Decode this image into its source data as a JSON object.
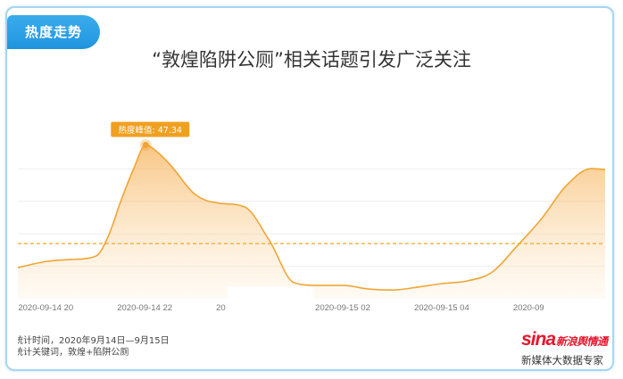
{
  "header": {
    "tab_label": "热度走势",
    "title": "“敦煌陷阱公厕”相关话题引发广泛关注"
  },
  "chart_data": {
    "type": "area",
    "x": [
      "2020-09-14 19:25",
      "2020-09-14 20:00",
      "2020-09-14 20:30",
      "2020-09-14 21:00",
      "2020-09-14 21:15",
      "2020-09-14 21:30",
      "2020-09-14 21:45",
      "2020-09-14 22:00",
      "2020-09-14 22:15",
      "2020-09-14 22:30",
      "2020-09-14 23:00",
      "2020-09-14 23:30",
      "2020-09-15 00:00",
      "2020-09-15 00:30",
      "2020-09-15 01:00",
      "2020-09-15 01:30",
      "2020-09-15 02:00",
      "2020-09-15 02:30",
      "2020-09-15 03:00",
      "2020-09-15 03:30",
      "2020-09-15 04:00",
      "2020-09-15 04:30",
      "2020-09-15 05:00",
      "2020-09-15 05:30",
      "2020-09-15 06:00",
      "2020-09-15 06:30",
      "2020-09-15 07:00",
      "2020-09-15 07:17"
    ],
    "series": [
      {
        "values": [
          9.6,
          11.5,
          12.1,
          13.2,
          19.5,
          30.2,
          39.8,
          47.34,
          45.0,
          41.2,
          32.1,
          29.4,
          28.3,
          17.9,
          4.9,
          4.1,
          4.1,
          3.0,
          2.7,
          3.6,
          4.7,
          5.5,
          8.2,
          16.2,
          24.7,
          34.9,
          40.1,
          39.8
        ]
      }
    ],
    "xlim": [
      "2020-09-14 19:25",
      "2020-09-15 07:17"
    ],
    "ylim": [
      0,
      50
    ],
    "grid": true,
    "y_grid": [
      10,
      20,
      30,
      40
    ],
    "x_ticks": [
      {
        "at": "2020-09-14 20:00",
        "label": "2020-09-14 20"
      },
      {
        "at": "2020-09-14 22:00",
        "label": "2020-09-14 22"
      },
      {
        "at": "2020-09-15 00:00",
        "label": "20"
      },
      {
        "at": "2020-09-15 02:00",
        "label": "2020-09-15 02"
      },
      {
        "at": "2020-09-15 04:00",
        "label": "2020-09-15 04"
      },
      {
        "at": "2020-09-15 06:00",
        "label": "2020-09"
      }
    ],
    "reference_line": {
      "value": 17,
      "style": "dashed"
    },
    "peak": {
      "x": "2020-09-14 22:00",
      "value": 47.34,
      "annotation": "热度峰值: 47.34"
    },
    "colors": {
      "line": "#f0a535",
      "fill_top": "#f4a032",
      "fill_bottom": "#ffecd2",
      "reference": "#f5a623",
      "annotation_bg": "#f0a020",
      "grid": "#eeeeee"
    }
  },
  "footer": {
    "stat_time": "统计时间，2020年9月14日—9月15日",
    "stat_keywords": "统计关键词，敦煌+陷阱公厕"
  },
  "brand": {
    "logo_text": "sina",
    "name": "新浪舆情通",
    "tagline": "新媒体大数据专家",
    "color": "#e6162d"
  },
  "theme": {
    "accent": "#2b9fe6",
    "border": "#a6d6f4"
  }
}
